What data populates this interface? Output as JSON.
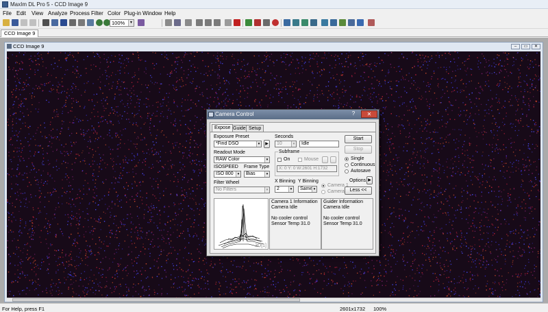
{
  "window": {
    "title": "MaxIm DL Pro 5 - CCD Image 9"
  },
  "menu": [
    "File",
    "Edit",
    "View",
    "Analyze",
    "Process",
    "Filter",
    "Color",
    "Plug-in",
    "Window",
    "Help"
  ],
  "toolbar": {
    "zoom_value": "100%"
  },
  "doc_tab": {
    "label": "CCD Image 9"
  },
  "image_window": {
    "title": "CCD Image 9",
    "background": "#170a18",
    "speckle_colors": [
      "#b8203a",
      "#3a30c8",
      "#7a1f6a",
      "#c84a2a",
      "#4a4af0"
    ]
  },
  "status": {
    "help": "For Help, press F1",
    "dims": "2601x1732",
    "zoom": "100%"
  },
  "dialog": {
    "title": "Camera Control",
    "help_btn": "?",
    "close_btn": "✕",
    "tabs": [
      "Expose",
      "Guide",
      "Setup"
    ],
    "exposure_preset_label": "Exposure Preset",
    "exposure_preset_value": "*Find DSO",
    "readout_mode_label": "Readout Mode",
    "readout_mode_value": "RAW Color",
    "isospeed_label": "ISOSPEED",
    "isospeed_value": "ISO 800",
    "frame_type_label": "Frame Type",
    "frame_type_value": "Bias",
    "filter_wheel_label": "Filter Wheel",
    "filter_wheel_value": "No Filters",
    "seconds_label": "Seconds",
    "seconds_value": "10",
    "status_value": "Idle",
    "subframe_label": "Subframe",
    "subframe_on": "On",
    "subframe_mouse": "Mouse",
    "subframe_coords": "X:    0 Y:    0 W:2601 H:1732",
    "x_binning_label": "X Binning",
    "x_binning_value": "2",
    "y_binning_label": "Y Binning",
    "y_binning_value": "Same",
    "camera1_radio": "Camera 1",
    "camera2_radio": "Camera 2",
    "start_btn": "Start",
    "stop_btn": "Stop",
    "mode_single": "Single",
    "mode_continuous": "Continuous",
    "mode_autosave": "Autosave",
    "options_btn": "Options",
    "less_btn": "Less <<",
    "graph_label": "3D[1]",
    "camera1_info": [
      "Camera 1 Information",
      "Camera Idle",
      "",
      "No cooler control",
      "Sensor Temp 31.0"
    ],
    "guider_info": [
      "Guider Information",
      "Camera Idle",
      "",
      "No cooler control",
      "Sensor Temp 31.0"
    ]
  }
}
